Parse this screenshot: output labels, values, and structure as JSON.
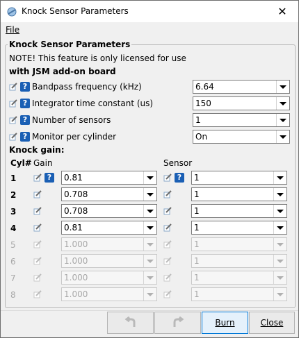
{
  "window": {
    "title": "Knock Sensor Parameters"
  },
  "menu": {
    "file": "File"
  },
  "group": {
    "title": "Knock Sensor Parameters",
    "note_line1": "NOTE! This feature is only licensed for use",
    "note_line2": "with JSM add-on board"
  },
  "params": [
    {
      "label": "Bandpass frequency (kHz)",
      "value": "6.64"
    },
    {
      "label": "Integrator time constant (us)",
      "value": "150"
    },
    {
      "label": "Number of sensors",
      "value": "1"
    },
    {
      "label": "Monitor per cylinder",
      "value": "On"
    }
  ],
  "gain": {
    "title": "Knock gain:",
    "col_cyl": "Cyl#",
    "col_gain": "Gain",
    "col_sensor": "Sensor",
    "rows": [
      {
        "cyl": "1",
        "gain": "0.81",
        "sensor": "1",
        "enabled": true
      },
      {
        "cyl": "2",
        "gain": "0.708",
        "sensor": "1",
        "enabled": true
      },
      {
        "cyl": "3",
        "gain": "0.708",
        "sensor": "1",
        "enabled": true
      },
      {
        "cyl": "4",
        "gain": "0.81",
        "sensor": "1",
        "enabled": true
      },
      {
        "cyl": "5",
        "gain": "1.000",
        "sensor": "1",
        "enabled": false
      },
      {
        "cyl": "6",
        "gain": "1.000",
        "sensor": "1",
        "enabled": false
      },
      {
        "cyl": "7",
        "gain": "1.000",
        "sensor": "1",
        "enabled": false
      },
      {
        "cyl": "8",
        "gain": "1.000",
        "sensor": "1",
        "enabled": false
      }
    ]
  },
  "buttons": {
    "burn": "Burn",
    "close": "Close"
  },
  "colors": {
    "help_icon": "#1a5fb4",
    "disabled_text": "#a8a8a8"
  }
}
